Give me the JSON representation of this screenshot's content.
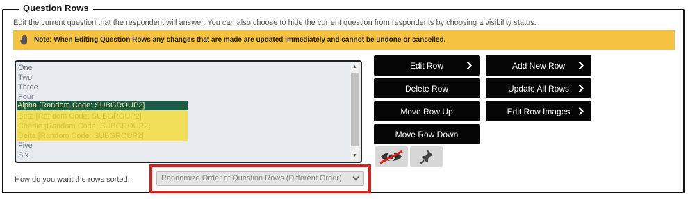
{
  "section": {
    "title": "Question Rows",
    "description": "Edit the current question that the respondent will answer. You can also choose to hide the current question from respondents by choosing a visibility status.",
    "note": "Note: When Editing Question Rows any changes that are made are updated immediately and cannot be undone or cancelled."
  },
  "rows": [
    "One",
    "Two",
    "Three",
    "Four",
    "Alpha [Random Code: SUBGROUP2]",
    "Beta [Random Code: SUBGROUP2]",
    "Charlie [Random Code: SUBGROUP2]",
    "Delta [Random Code: SUBGROUP2]",
    "Five",
    "Six"
  ],
  "selected_row": "Alpha [Random Code: SUBGROUP2]",
  "buttons": {
    "edit_row": "Edit Row",
    "delete_row": "Delete Row",
    "move_row_up": "Move Row Up",
    "move_row_down": "Move Row Down",
    "add_new_row": "Add New Row",
    "update_all_rows": "Update All Rows",
    "edit_row_images": "Edit Row Images"
  },
  "sort": {
    "label": "How do you want the rows sorted:",
    "selected": "Randomize Order of Question Rows (Different Order)"
  },
  "icons": {
    "visibility": "eye-hidden-icon",
    "pin": "pin-icon",
    "note": "hand-icon"
  },
  "colors": {
    "note_bg": "#f6c242",
    "highlight": "#f5dc28",
    "selection": "#1f66c5",
    "red_outline": "#d91e1e",
    "button": "#050505"
  }
}
